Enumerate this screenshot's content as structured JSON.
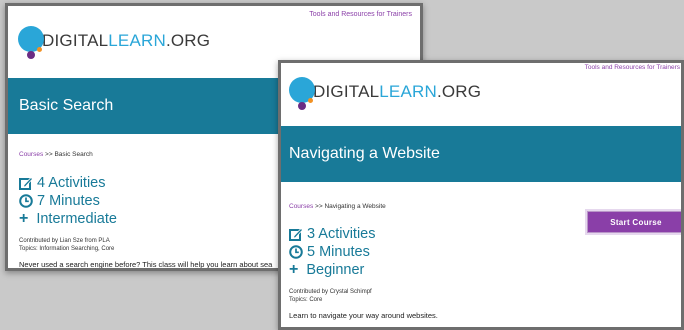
{
  "window1": {
    "top_link": "Tools and Resources for Trainers",
    "logo": {
      "digital": "DIGITAL",
      "learn": "LEARN",
      "org": ".ORG"
    },
    "course_title": "Basic Search",
    "breadcrumb": {
      "courses": "Courses",
      "sep": " >> ",
      "current": "Basic Search"
    },
    "stats": {
      "activities": "4 Activities",
      "minutes": "7 Minutes",
      "level": "Intermediate"
    },
    "contributed": "Contributed by Lian Sze from PLA",
    "topics": "Topics: Information Searching, Core",
    "description": "Never used a search engine before? This class will help you learn about sea"
  },
  "window2": {
    "top_link": "Tools and Resources for Trainers",
    "logo": {
      "digital": "DIGITAL",
      "learn": "LEARN",
      "org": ".ORG"
    },
    "course_title": "Navigating a Website",
    "breadcrumb": {
      "courses": "Courses",
      "sep": " >> ",
      "current": "Navigating a Website"
    },
    "stats": {
      "activities": "3 Activities",
      "minutes": "5 Minutes",
      "level": "Beginner"
    },
    "contributed": "Contributed by Crystal Schimpf",
    "topics": "Topics: Core",
    "description": "Learn to navigate your way around websites.",
    "start_button": "Start Course"
  },
  "colors": {
    "banner": "#187a98",
    "accent_purple": "#8a3fa8",
    "logo_blue": "#2aa6d8"
  },
  "icons": {
    "activities": "checkbox-pencil-icon",
    "minutes": "clock-icon",
    "level": "plus-icon"
  }
}
